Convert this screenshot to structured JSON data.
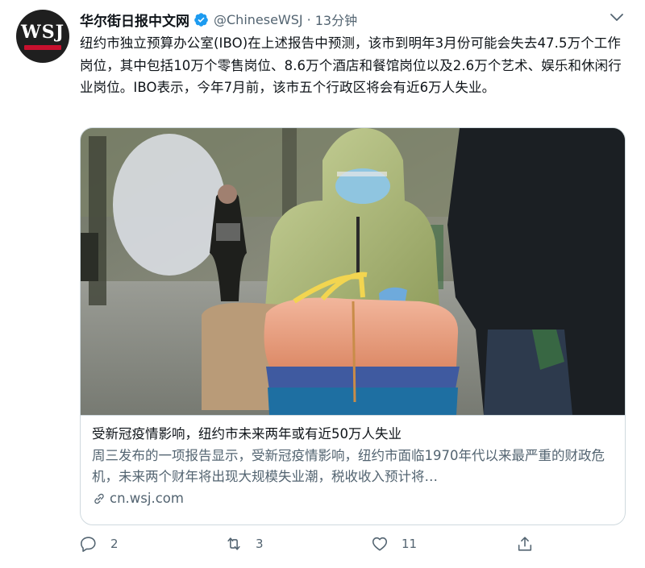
{
  "account": {
    "name": "华尔街日报中文网",
    "handle": "@ChineseWSJ",
    "separator": "·",
    "time": "13分钟",
    "logo_text": "WSJ"
  },
  "tweet": {
    "text": "纽约市独立预算办公室(IBO)在上述报告中预测，该市到明年3月份可能会失去47.5万个工作岗位，其中包括10万个零售岗位、8.6万个酒店和餐馆岗位以及2.6万个艺术、娱乐和休闲行业岗位。IBO表示，今年7月前，该市五个行政区将会有近6万人失业。"
  },
  "card": {
    "title": "受新冠疫情影响，纽约市未来两年或有近50万人失业",
    "description": "周三发布的一项报告显示，受新冠疫情影响，纽约市面临1970年代以来最严重的财政危机，未来两个财年将出现大规模失业潮，税收收入预计将…",
    "domain": "cn.wsj.com"
  },
  "actions": {
    "reply_count": "2",
    "retweet_count": "3",
    "like_count": "11",
    "share_label": ""
  },
  "colors": {
    "verified": "#1d9bf0",
    "secondary_text": "#536471",
    "border": "#cfd9de",
    "brand_red": "#c8102e"
  },
  "icons": [
    "chevron-down-icon",
    "verified-badge-icon",
    "link-icon",
    "reply-icon",
    "retweet-icon",
    "like-icon",
    "share-icon"
  ]
}
